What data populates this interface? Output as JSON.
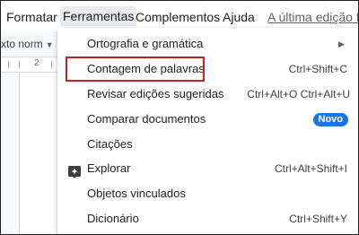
{
  "menubar": {
    "items": [
      {
        "label": "Formatar"
      },
      {
        "label": "Ferramentas"
      },
      {
        "label": "Complementos"
      },
      {
        "label": "Ajuda"
      }
    ],
    "last_edit": "A última edição foi"
  },
  "toolbar": {
    "style_select": "xto norm"
  },
  "ruler": {
    "number": "2"
  },
  "tools_menu": {
    "items": [
      {
        "label": "Ortografia e gramática",
        "shortcut": "",
        "has_submenu": true
      },
      {
        "label": "Contagem de palavras",
        "shortcut": "Ctrl+Shift+C",
        "highlighted": true
      },
      {
        "label": "Revisar edições sugeridas",
        "shortcut": "Ctrl+Alt+O Ctrl+Alt+U"
      },
      {
        "label": "Comparar documentos",
        "badge": "Novo"
      },
      {
        "label": "Citações",
        "shortcut": ""
      },
      {
        "label": "Explorar",
        "shortcut": "Ctrl+Alt+Shift+I",
        "icon": "explore-icon"
      },
      {
        "label": "Objetos vinculados",
        "shortcut": ""
      },
      {
        "label": "Dicionário",
        "shortcut": "Ctrl+Shift+Y"
      }
    ]
  },
  "colors": {
    "accent": "#1a73e8",
    "highlight_border": "#c5221f",
    "active_menu_bg": "#e8eaed"
  }
}
